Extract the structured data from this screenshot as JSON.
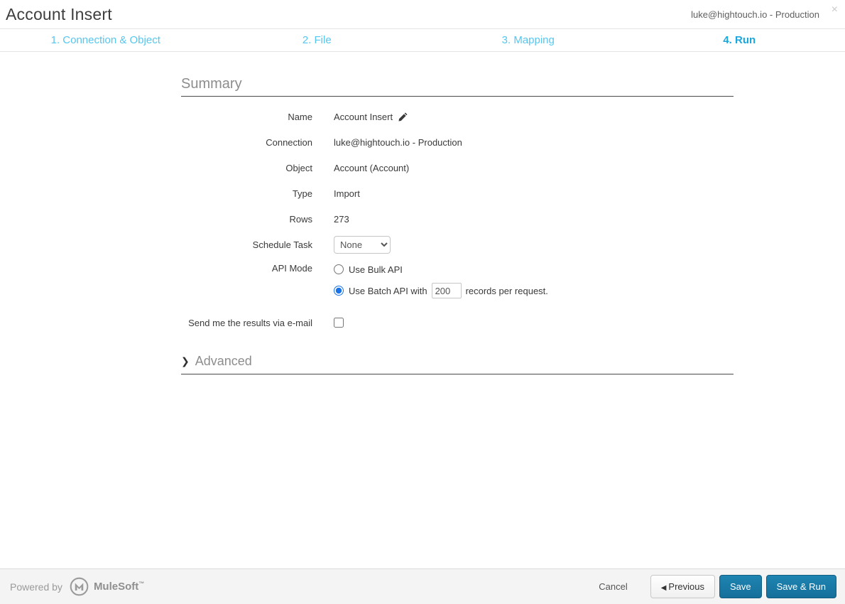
{
  "header": {
    "title": "Account Insert",
    "connection_badge": "luke@hightouch.io - Production",
    "close_icon": "×"
  },
  "steps": [
    {
      "label": "1. Connection & Object",
      "active": false
    },
    {
      "label": "2. File",
      "active": false
    },
    {
      "label": "3. Mapping",
      "active": false
    },
    {
      "label": "4. Run",
      "active": true
    }
  ],
  "summary": {
    "heading": "Summary",
    "rows": [
      {
        "label": "Name",
        "value": "Account Insert"
      },
      {
        "label": "Connection",
        "value": "luke@hightouch.io - Production"
      },
      {
        "label": "Object",
        "value": "Account (Account)"
      },
      {
        "label": "Type",
        "value": "Import"
      },
      {
        "label": "Rows",
        "value": "273"
      }
    ],
    "schedule_task": {
      "label": "Schedule Task",
      "selected_option": "None"
    },
    "api_mode": {
      "label": "API Mode",
      "bulk": {
        "label": "Use Bulk API",
        "selected": false
      },
      "batch": {
        "prefix": "Use Batch API with",
        "value": "200",
        "suffix": "records per request.",
        "selected": true
      }
    },
    "email": {
      "label": "Send me the results via e-mail",
      "checked": false
    }
  },
  "advanced": {
    "chevron": "❯",
    "label": "Advanced"
  },
  "footer": {
    "powered_by": "Powered by",
    "brand": "MuleSoft",
    "trademark": "™",
    "cancel_label": "Cancel",
    "previous_arrow": "◀",
    "previous_label": "Previous",
    "save_label": "Save",
    "save_run_label": "Save & Run"
  },
  "colors": {
    "step_inactive": "#55c6ef",
    "step_active": "#19a7dd",
    "button_blue": "#1b7aa9",
    "radio_accent": "#1a73e8",
    "heading_gray": "#8d8d8d",
    "footer_bg": "#f4f4f4"
  }
}
